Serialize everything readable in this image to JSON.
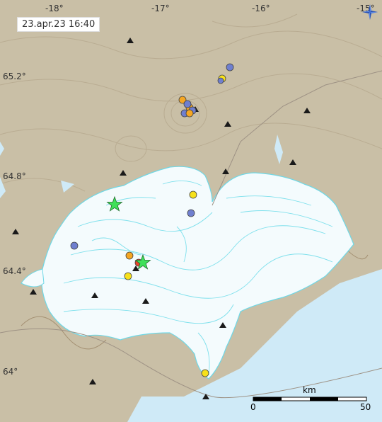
{
  "timestamp": "23.apr.23  16:40",
  "lon_labels": [
    "-18°",
    "-17°",
    "-16°",
    "-15°"
  ],
  "lat_labels": [
    "65.2°",
    "64.8°",
    "64.4°",
    "64°"
  ],
  "scale": {
    "unit": "km",
    "start": "0",
    "end": "50"
  },
  "compass": "compass-rose",
  "colors": {
    "land": "#c9bfa6",
    "ice": "#f4fbfd",
    "sea": "#cfeaf7",
    "quake_blue": "#6f7fcf",
    "quake_orange": "#f5a623",
    "quake_yellow": "#f7e11a",
    "star": "#3fe05a"
  }
}
